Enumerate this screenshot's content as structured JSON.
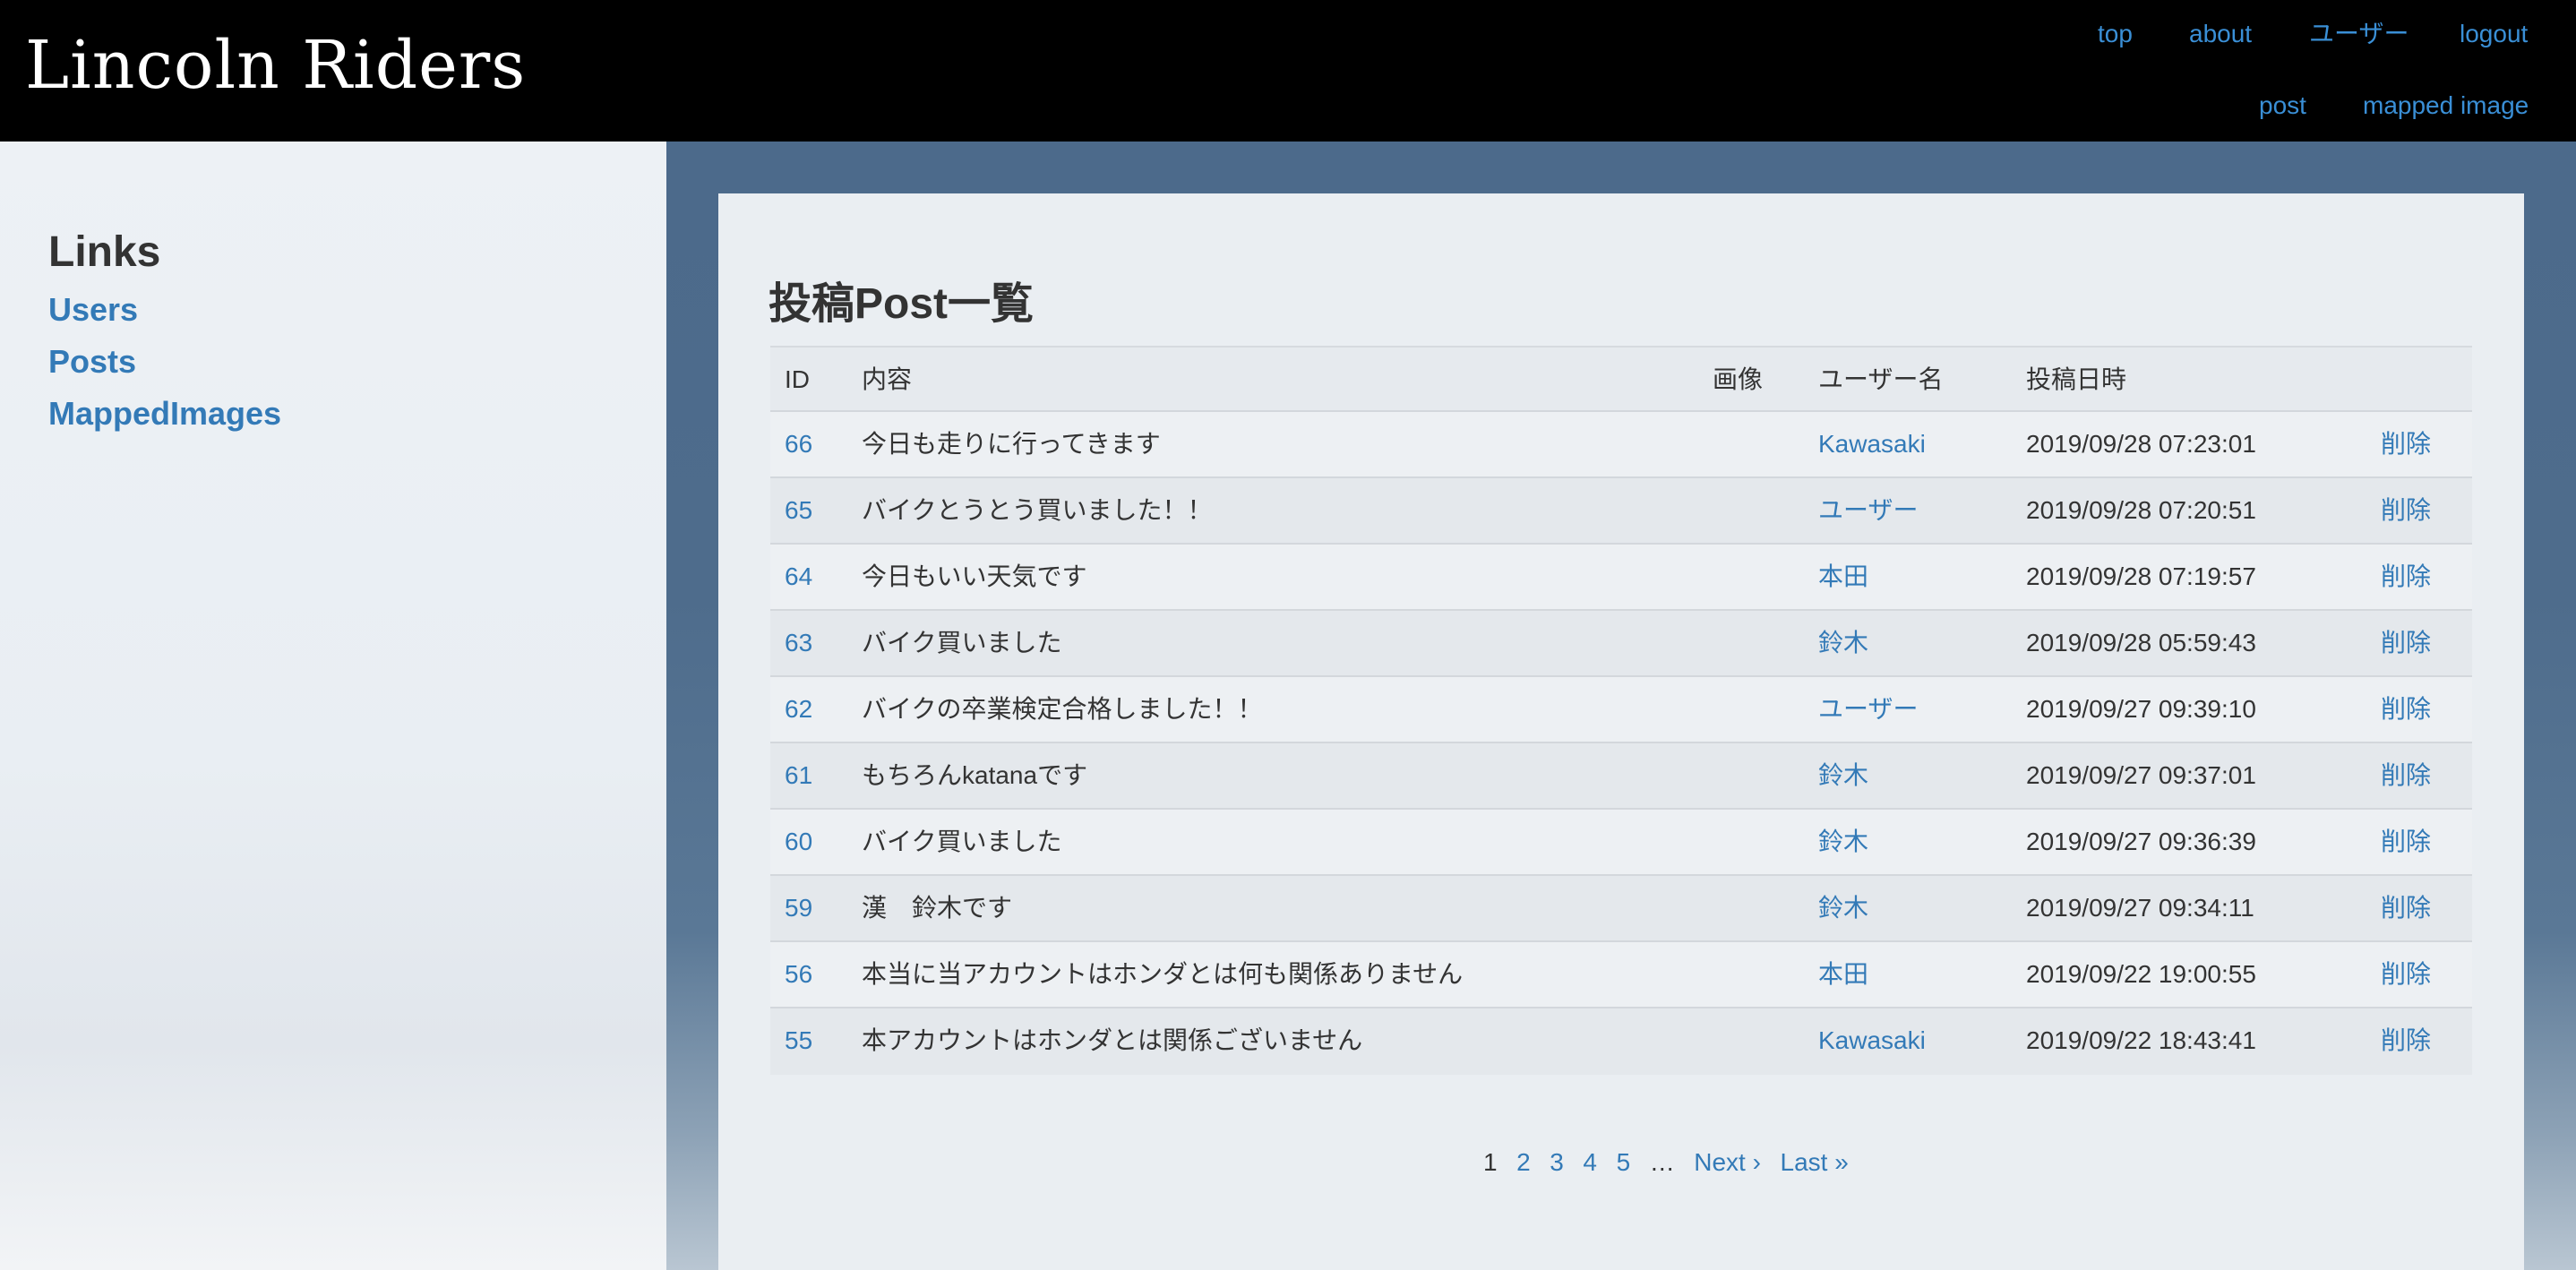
{
  "header": {
    "brand": "Lincoln Riders",
    "nav_row1": [
      "top",
      "about",
      "ユーザー",
      "logout"
    ],
    "nav_row2": [
      "post",
      "mapped image"
    ]
  },
  "sidebar": {
    "heading": "Links",
    "links": [
      "Users",
      "Posts",
      "MappedImages"
    ]
  },
  "main": {
    "title": "投稿Post一覧",
    "columns": [
      "ID",
      "内容",
      "画像",
      "ユーザー名",
      "投稿日時"
    ],
    "rows": [
      {
        "id": "66",
        "content": "今日も走りに行ってきます",
        "image": "",
        "user": "Kawasaki",
        "date": "2019/09/28 07:23:01",
        "action": "削除"
      },
      {
        "id": "65",
        "content": "バイクとうとう買いました！！",
        "image": "",
        "user": "ユーザー",
        "date": "2019/09/28 07:20:51",
        "action": "削除"
      },
      {
        "id": "64",
        "content": "今日もいい天気です",
        "image": "",
        "user": "本田",
        "date": "2019/09/28 07:19:57",
        "action": "削除"
      },
      {
        "id": "63",
        "content": "バイク買いました",
        "image": "",
        "user": "鈴木",
        "date": "2019/09/28 05:59:43",
        "action": "削除"
      },
      {
        "id": "62",
        "content": "バイクの卒業検定合格しました！！",
        "image": "",
        "user": "ユーザー",
        "date": "2019/09/27 09:39:10",
        "action": "削除"
      },
      {
        "id": "61",
        "content": "もちろんkatanaです",
        "image": "",
        "user": "鈴木",
        "date": "2019/09/27 09:37:01",
        "action": "削除"
      },
      {
        "id": "60",
        "content": "バイク買いました",
        "image": "",
        "user": "鈴木",
        "date": "2019/09/27 09:36:39",
        "action": "削除"
      },
      {
        "id": "59",
        "content": "漢　鈴木です",
        "image": "",
        "user": "鈴木",
        "date": "2019/09/27 09:34:11",
        "action": "削除"
      },
      {
        "id": "56",
        "content": "本当に当アカウントはホンダとは何も関係ありません",
        "image": "",
        "user": "本田",
        "date": "2019/09/22 19:00:55",
        "action": "削除"
      },
      {
        "id": "55",
        "content": "本アカウントはホンダとは関係ございません",
        "image": "",
        "user": "Kawasaki",
        "date": "2019/09/22 18:43:41",
        "action": "削除"
      }
    ]
  },
  "pagination": {
    "current": "1",
    "pages": [
      "2",
      "3",
      "4",
      "5"
    ],
    "ellipsis": "…",
    "next": "Next ›",
    "last": "Last »"
  },
  "colors": {
    "header_bg": "#000000",
    "nav_link": "#3a8fd6",
    "link": "#337ab7",
    "text": "#333333",
    "panel_bg": "#eaeef2",
    "backdrop": "#4c6a8b"
  }
}
